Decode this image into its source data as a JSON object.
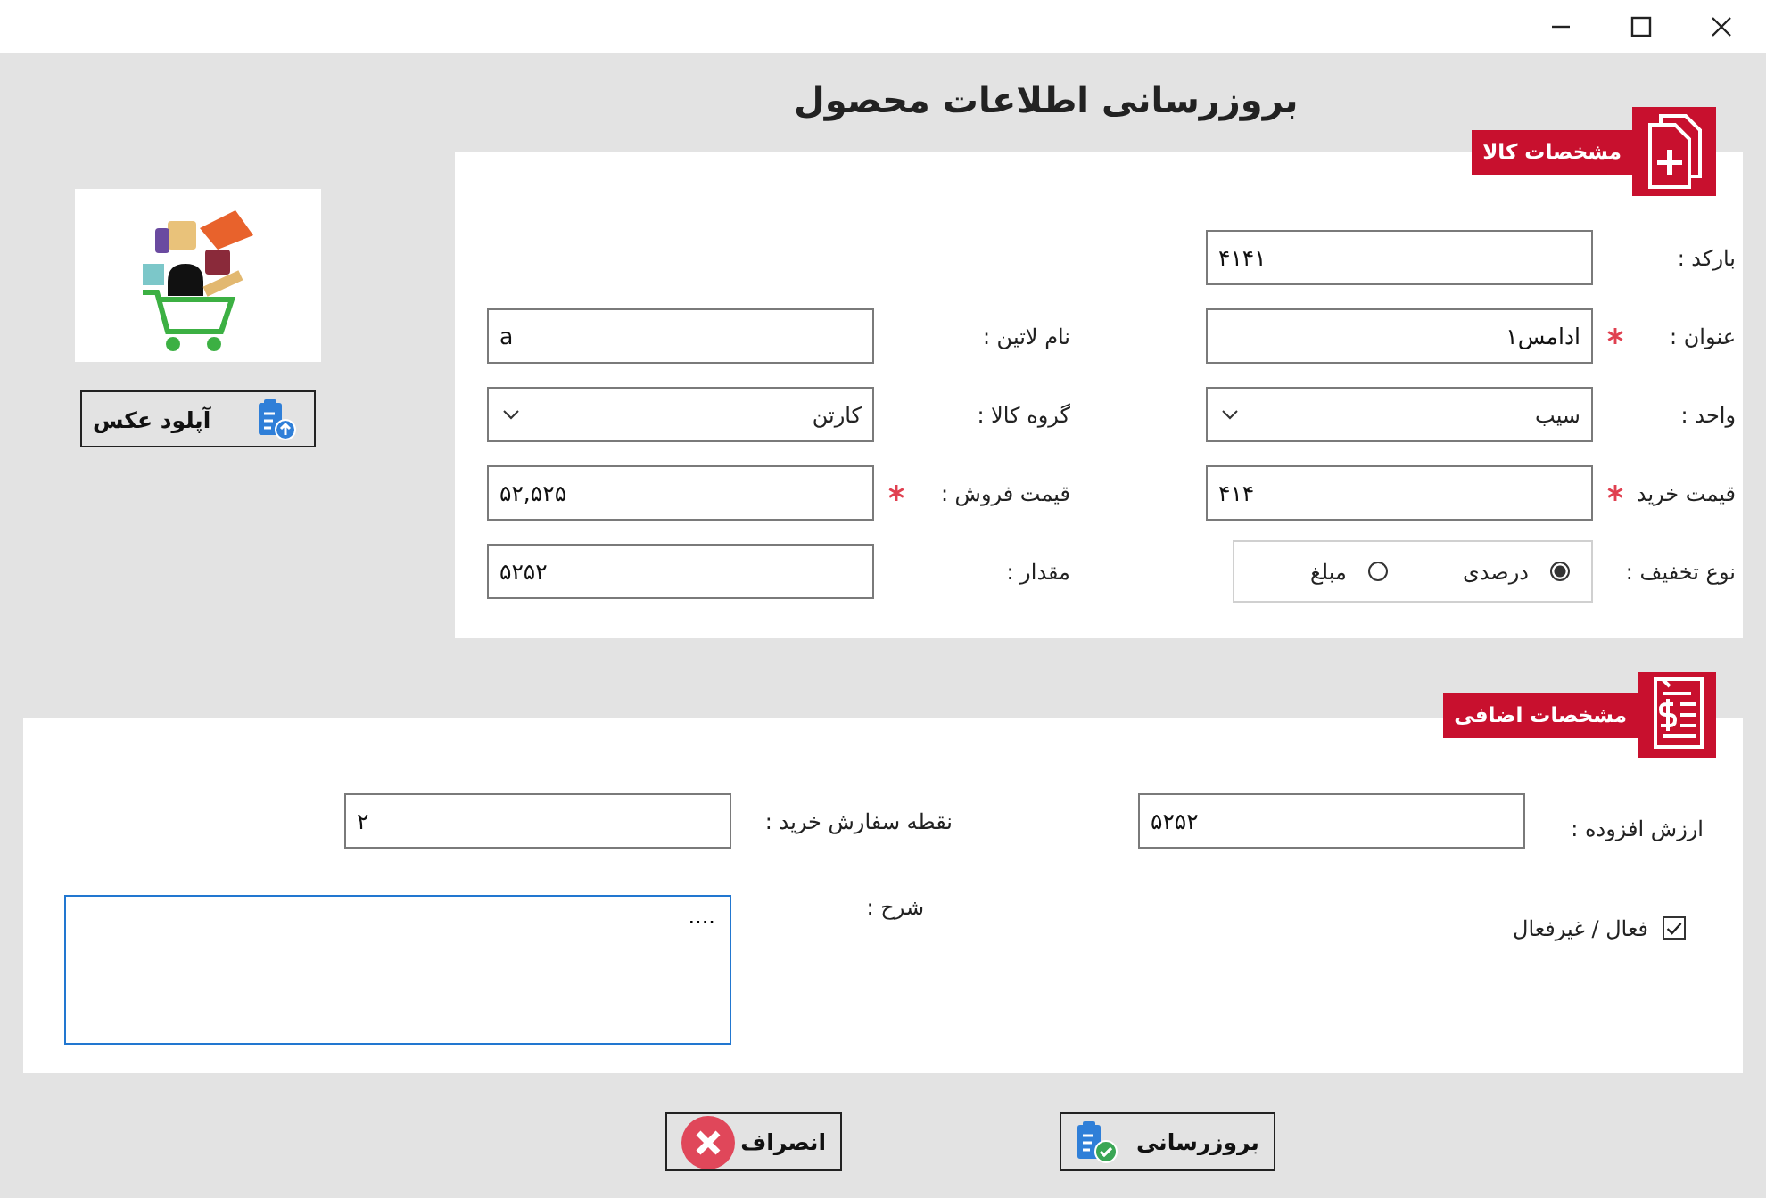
{
  "heading": "بروزرسانی اطلاعات محصول",
  "image_upload": {
    "button": "آپلود عکس"
  },
  "product_details": {
    "title": "مشخصات کالا",
    "columns": [
      [
        {
          "kind": "text",
          "label": "بارکد :",
          "value": "۴۱۴۱",
          "required": false
        },
        {
          "kind": "text",
          "label": "عنوان :",
          "value": "ادامس۱",
          "required": true
        },
        {
          "kind": "select",
          "label": "واحد :",
          "value": "سیب",
          "required": false
        },
        {
          "kind": "text",
          "label": "قیمت خرید",
          "value": "۴۱۴",
          "required": true
        },
        {
          "kind": "radio",
          "label": "نوع تخفیف :",
          "options": [
            {
              "label": "درصدی",
              "selected": true
            },
            {
              "label": "مبلغ",
              "selected": false
            }
          ]
        }
      ],
      [
        {
          "kind": "text",
          "label": "نام لاتین :",
          "value": "a",
          "required": false
        },
        {
          "kind": "select",
          "label": "گروه کالا :",
          "value": "کارتن",
          "required": false
        },
        {
          "kind": "text",
          "label": "قیمت فروش :",
          "value": "۵۲,۵۲۵",
          "required": true
        },
        {
          "kind": "text",
          "label": "مقدار :",
          "value": "۵۲۵۲",
          "required": false
        }
      ]
    ]
  },
  "extra_details": {
    "title": "مشخصات اضافی",
    "value_added": {
      "label": "ارزش افزوده :",
      "value": "۵۲۵۲"
    },
    "reorder_point": {
      "label": "نقطه سفارش خرید :",
      "value": "۲"
    },
    "active": {
      "label": "فعال / غیرفعال",
      "checked": true
    },
    "description": {
      "label": "شرح :",
      "value": "...."
    }
  },
  "buttons": [
    {
      "kind": "update",
      "label": "بروزرسانی"
    },
    {
      "kind": "cancel",
      "label": "انصراف"
    }
  ]
}
